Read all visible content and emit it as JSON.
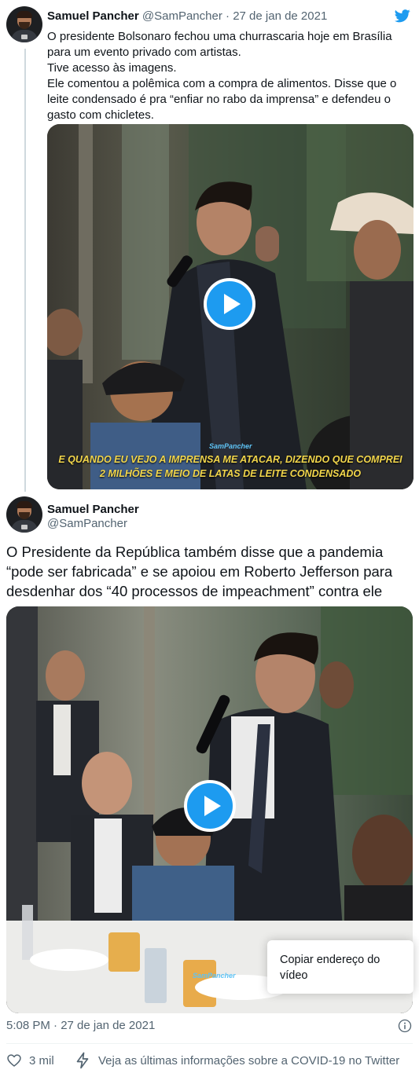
{
  "tweet1": {
    "author_name": "Samuel Pancher",
    "handle": "@SamPancher",
    "separator": " · ",
    "date": "27 de jan de 2021",
    "text_lines": [
      "O presidente Bolsonaro fechou uma churrascaria hoje em Brasília para um evento privado com artistas.",
      "Tive acesso às imagens.",
      "Ele comentou a polêmica com a compra de alimentos. Disse que o leite condensado é pra “enfiar no rabo da imprensa” e defendeu o gasto com chicletes."
    ],
    "video": {
      "subtitle_line1": "E QUANDO EU VEJO A IMPRENSA ME ATACAR, DIZENDO QUE COMPREI",
      "subtitle_line2": "2 MILHÕES E MEIO DE LATAS DE LEITE CONDENSADO",
      "watermark": "SamPancher"
    }
  },
  "tweet2": {
    "author_name": "Samuel Pancher",
    "handle": "@SamPancher",
    "text": "O Presidente da República também disse que a pandemia “pode ser fabricada” e se apoiou em Roberto Jefferson para desdenhar dos “40 processos de impeachment” contra ele",
    "video": {
      "watermark": "SamPancher"
    },
    "context_menu": {
      "copy_video_address": "Copiar endereço do vídeo"
    },
    "timestamp": "5:08 PM · 27 de jan de 2021"
  },
  "footer": {
    "likes": "3 mil",
    "covid_info": "Veja as últimas informações sobre a COVID-19 no Twitter"
  },
  "colors": {
    "accent": "#1d9bf0",
    "text_primary": "#0f1419",
    "text_secondary": "#536471",
    "subtitle": "#f2d64b"
  }
}
